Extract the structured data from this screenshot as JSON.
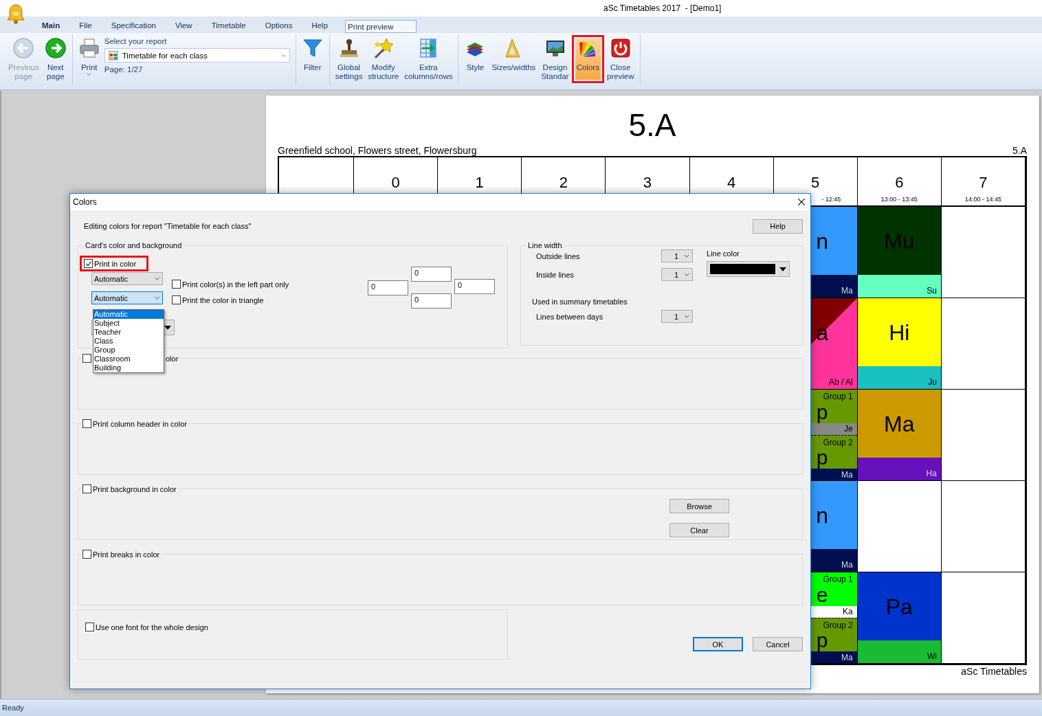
{
  "window": {
    "title": "aSc Timetables 2017  - [Demo1]"
  },
  "ribbon_tabs": [
    {
      "label": "Main",
      "kind": "home",
      "selected": false
    },
    {
      "label": "File",
      "kind": "tab",
      "selected": false
    },
    {
      "label": "Specification",
      "kind": "tab",
      "selected": false
    },
    {
      "label": "View",
      "kind": "tab",
      "selected": false
    },
    {
      "label": "Timetable",
      "kind": "tab",
      "selected": false
    },
    {
      "label": "Options",
      "kind": "tab",
      "selected": false
    },
    {
      "label": "Help",
      "kind": "tab",
      "selected": false
    },
    {
      "label": "Print preview",
      "kind": "tab",
      "selected": true
    }
  ],
  "toolbar": {
    "groups": [
      {
        "items": [
          {
            "kind": "button",
            "lines": [
              "Previous",
              "page"
            ],
            "disabled": true,
            "active": false,
            "annotated": false,
            "menu": false
          },
          {
            "kind": "button",
            "lines": [
              "Next",
              "page"
            ],
            "disabled": false,
            "active": false,
            "annotated": false,
            "menu": false
          }
        ]
      },
      {
        "items": [
          {
            "kind": "button",
            "lines": [
              "Print"
            ],
            "disabled": false,
            "active": false,
            "annotated": false,
            "menu": true
          },
          {
            "kind": "report",
            "caption": "Select your report",
            "value": "Timetable for each class",
            "page": "Page: 1/27"
          }
        ]
      },
      {
        "items": [
          {
            "kind": "button",
            "lines": [
              "Filter"
            ],
            "disabled": false,
            "active": false,
            "annotated": false,
            "menu": false
          }
        ]
      },
      {
        "items": [
          {
            "kind": "button",
            "lines": [
              "Global",
              "settings"
            ],
            "disabled": false,
            "active": false,
            "annotated": false,
            "menu": false
          },
          {
            "kind": "button",
            "lines": [
              "Modify",
              "structure"
            ],
            "disabled": false,
            "active": false,
            "annotated": false,
            "menu": false
          },
          {
            "kind": "button",
            "lines": [
              "Extra",
              "columns/rows"
            ],
            "disabled": false,
            "active": false,
            "annotated": false,
            "menu": false
          }
        ]
      },
      {
        "items": [
          {
            "kind": "button",
            "lines": [
              "Style"
            ],
            "disabled": false,
            "active": false,
            "annotated": false,
            "menu": false
          },
          {
            "kind": "button",
            "lines": [
              "Sizes/widths"
            ],
            "disabled": false,
            "active": false,
            "annotated": false,
            "menu": false
          },
          {
            "kind": "button",
            "lines": [
              "Design",
              "Standar"
            ],
            "disabled": false,
            "active": false,
            "annotated": false,
            "menu": false
          },
          {
            "kind": "button",
            "lines": [
              "Colors"
            ],
            "disabled": false,
            "active": true,
            "annotated": true,
            "menu": false
          },
          {
            "kind": "button",
            "lines": [
              "Close",
              "preview"
            ],
            "disabled": false,
            "active": false,
            "annotated": false,
            "menu": false
          }
        ]
      }
    ]
  },
  "timetable": {
    "title": "5.A",
    "school": "Greenfield school, Flowers street, Flowersburg",
    "class_label": "5.A",
    "columns": [
      {
        "number": "0"
      },
      {
        "number": "1"
      },
      {
        "number": "2"
      },
      {
        "number": "3"
      },
      {
        "number": "4"
      },
      {
        "number": "5",
        "time": "- 12:45"
      },
      {
        "number": "6",
        "time": "13:00 - 13:45"
      },
      {
        "number": "7",
        "time": "14:00 - 14:45"
      }
    ],
    "rows": [
      {
        "cells": [
          {
            "kind": "card",
            "subject": "n",
            "color": "#3399ff",
            "footer": {
              "text": "Ma",
              "color": "#000f50"
            }
          },
          {
            "kind": "card",
            "subject": "Mu",
            "color": "#003300",
            "footer": {
              "text": "Su",
              "color": "#66ffc0"
            }
          },
          {
            "kind": "empty"
          }
        ]
      },
      {
        "cells": [
          {
            "kind": "triangle",
            "subject": "a",
            "color": "#ff3399",
            "triangle": {
              "color": "#800000"
            },
            "footer": {
              "text": "Ab / Al",
              "color": "#ff3399"
            }
          },
          {
            "kind": "card",
            "subject": "Hi",
            "color": "#ffff00",
            "footer": {
              "text": "Ju",
              "color": "#19c0c0"
            }
          },
          {
            "kind": "empty"
          }
        ]
      },
      {
        "cells": [
          {
            "kind": "split",
            "groups": [
              {
                "group": "Group 1",
                "subject": "p",
                "color": "#669900",
                "footer": {
                  "text": "Je",
                  "color": "#888888"
                }
              },
              {
                "group": "Group 2",
                "subject": "p",
                "color": "#669900",
                "footer": {
                  "text": "Ma",
                  "color": "#000f50"
                }
              }
            ]
          },
          {
            "kind": "card",
            "subject": "Ma",
            "color": "#cc9900",
            "footer": {
              "text": "Ha",
              "color": "#6611bb"
            }
          },
          {
            "kind": "empty"
          }
        ]
      },
      {
        "cells": [
          {
            "kind": "card",
            "subject": "n",
            "color": "#3399ff",
            "footer": {
              "text": "Ma",
              "color": "#000f50"
            }
          },
          {
            "kind": "empty"
          },
          {
            "kind": "empty"
          }
        ]
      },
      {
        "cells": [
          {
            "kind": "split",
            "groups": [
              {
                "group": "Group 1",
                "subject": "e",
                "color": "#00ff00",
                "footer": {
                  "text": "Ka",
                  "color": "#ffffff"
                }
              },
              {
                "group": "Group 2",
                "subject": "p",
                "color": "#669900",
                "footer": {
                  "text": "Ma",
                  "color": "#000f50"
                }
              }
            ]
          },
          {
            "kind": "card",
            "subject": "Pa",
            "color": "#0033cc",
            "footer": {
              "text": "Wi",
              "color": "#19bb33"
            }
          },
          {
            "kind": "empty"
          }
        ]
      }
    ],
    "footer": "aSc Timetables"
  },
  "dialog": {
    "title": "Colors",
    "intro": "Editing colors for report \"Timetable for each class\"",
    "help": "Help",
    "card_group": {
      "legend": "Card's color and background",
      "print_in_color": {
        "label": "Print in color",
        "checked": true,
        "annotated": true
      },
      "selects": [
        {
          "value": "Automatic",
          "focused": false
        },
        {
          "value": "Automatic",
          "focused": true
        }
      ],
      "options": [
        {
          "label": "Automatic",
          "selected": true
        },
        {
          "label": "Subject",
          "selected": false
        },
        {
          "label": "Teacher",
          "selected": false
        },
        {
          "label": "Class",
          "selected": false
        },
        {
          "label": "Group",
          "selected": false
        },
        {
          "label": "Classroom",
          "selected": false
        },
        {
          "label": "Building",
          "selected": false
        }
      ],
      "checkboxes": [
        {
          "label": "Print color(s) in the left part only",
          "checked": false
        },
        {
          "label": "Print the color in triangle",
          "checked": false
        }
      ],
      "margins": [
        "0",
        "0",
        "0",
        "0"
      ]
    },
    "line_group": {
      "legend": "Line width",
      "rows": [
        {
          "label": "Outside lines",
          "value": "1"
        },
        {
          "label": "Inside lines",
          "value": "1"
        }
      ],
      "summary_caption": "Used in summary timetables",
      "summary_rows": [
        {
          "label": "Lines between days",
          "value": "1"
        }
      ],
      "line_color_label": "Line color",
      "line_color": {
        "color": "#000000"
      }
    },
    "sections": [
      {
        "label": "olor",
        "kind": "covered",
        "checked": false
      },
      {
        "label": "Print column header in color",
        "kind": "plain",
        "checked": false
      },
      {
        "label": "Print background in color",
        "kind": "plain",
        "checked": false,
        "buttons": [
          "Browse",
          "Clear"
        ]
      },
      {
        "label": "Print breaks in color",
        "kind": "plain",
        "checked": false
      }
    ],
    "font_option": {
      "label": "Use one font for the whole design",
      "checked": false
    },
    "buttons": [
      {
        "label": "OK",
        "default": true
      },
      {
        "label": "Cancel",
        "default": false
      }
    ]
  },
  "status_bar": {
    "text": "Ready"
  }
}
